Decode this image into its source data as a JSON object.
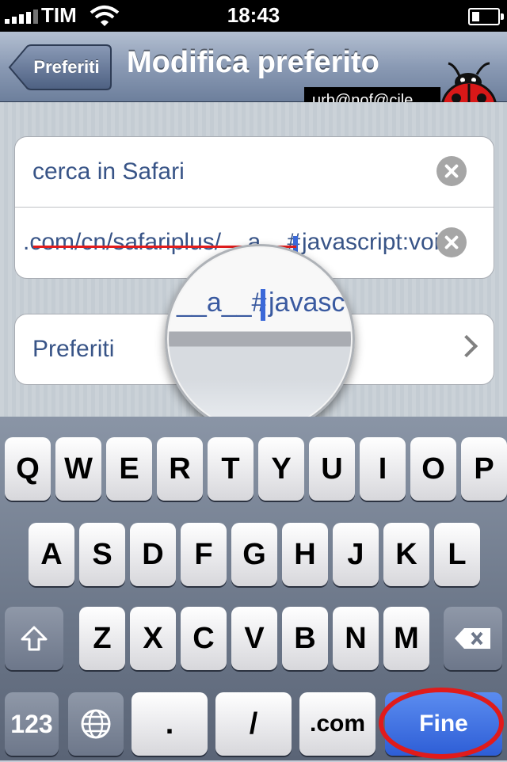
{
  "status_bar": {
    "carrier": "TIM",
    "time": "18:43"
  },
  "nav": {
    "back_label": "Preferiti",
    "title": "Modifica preferito"
  },
  "watermark": "urb@nof@cile",
  "form": {
    "title_value": "cerca in Safari",
    "url_value_left": ".com/cn/safariplus/__a__#",
    "url_value_right": "javascript:voi",
    "folder_label": "Preferiti"
  },
  "magnifier": {
    "text_left": "__a__#",
    "text_right": "javasc"
  },
  "keyboard": {
    "row1": [
      "Q",
      "W",
      "E",
      "R",
      "T",
      "Y",
      "U",
      "I",
      "O",
      "P"
    ],
    "row2": [
      "A",
      "S",
      "D",
      "F",
      "G",
      "H",
      "J",
      "K",
      "L"
    ],
    "row3": [
      "Z",
      "X",
      "C",
      "V",
      "B",
      "N",
      "M"
    ],
    "numbers_label": "123",
    "dot_label": ".",
    "slash_label": "/",
    "dotcom_label": ".com",
    "done_label": "Fine"
  },
  "colors": {
    "annotation": "#e01b1b",
    "accent": "#2e5ed6",
    "text_blue": "#385487"
  }
}
